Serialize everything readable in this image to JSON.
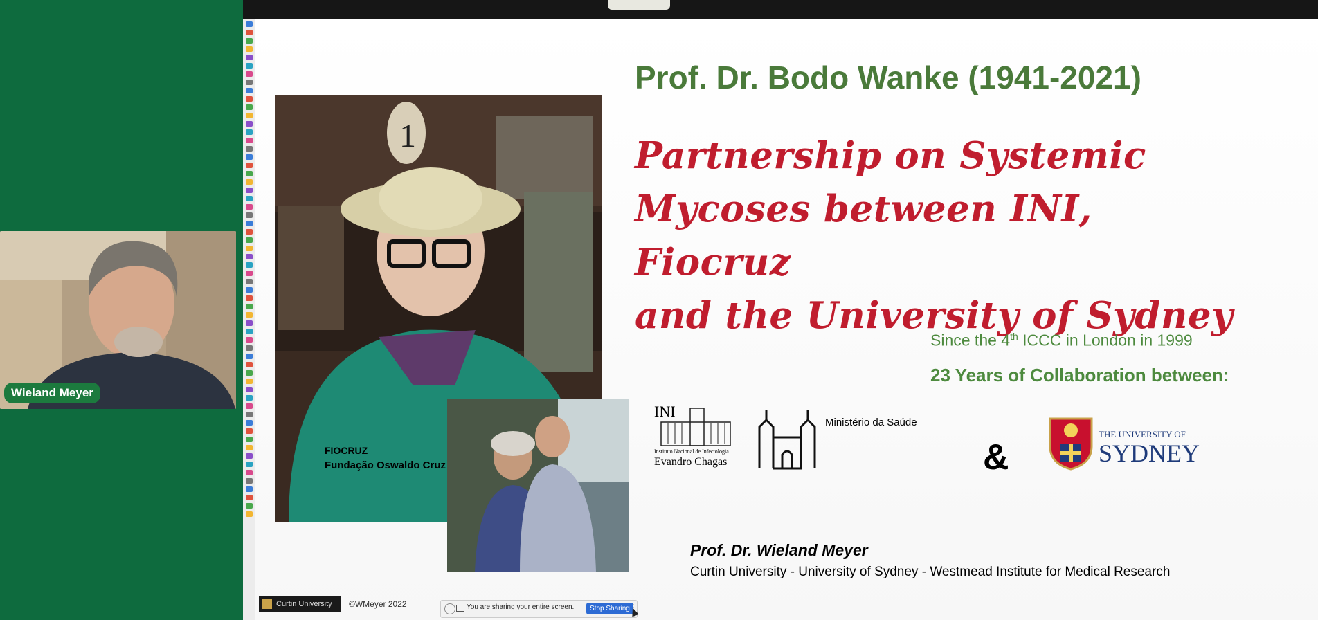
{
  "meeting": {
    "participant_name": "Wieland Meyer"
  },
  "slide": {
    "title": "Prof. Dr. Bodo Wanke (1941-2021)",
    "subtitle_lines": [
      "Partnership on Systemic",
      "Mycoses between INI, Fiocruz",
      "and the University of Sydney"
    ],
    "since_prefix": "Since the 4",
    "since_sup": "th",
    "since_suffix": " ICCC in London in 1999",
    "years_text": "23 Years of Collaboration between:",
    "logos": {
      "ini_text": "INI",
      "ini_small": "Instituto Nacional de Infectologia",
      "ini_name": "Evandro Chagas",
      "ministerio": "Ministério da Saúde",
      "fiocruz": "FIOCRUZ",
      "fiocruz_full": "Fundação Oswaldo Cruz",
      "ampersand": "&",
      "usyd_small": "THE UNIVERSITY OF",
      "usyd_big": "SYDNEY"
    },
    "presenter": "Prof. Dr. Wieland Meyer",
    "affiliation": "Curtin University - University of Sydney - Westmead Institute for Medical Research",
    "footer_logo": "Curtin University",
    "copyright": "©WMeyer 2022"
  },
  "share_bar": {
    "text": "You are sharing your entire screen.",
    "stop_label": "Stop Sharing",
    "more": "⋮"
  },
  "colors": {
    "sidebar_green": "#0e6b3e",
    "title_green": "#4a7a3a",
    "subtitle_red": "#c01d2e",
    "usyd_blue": "#1f3b7a"
  },
  "icons": [
    "pause-icon",
    "screen-share-icon",
    "more-icon",
    "cursor-icon"
  ]
}
